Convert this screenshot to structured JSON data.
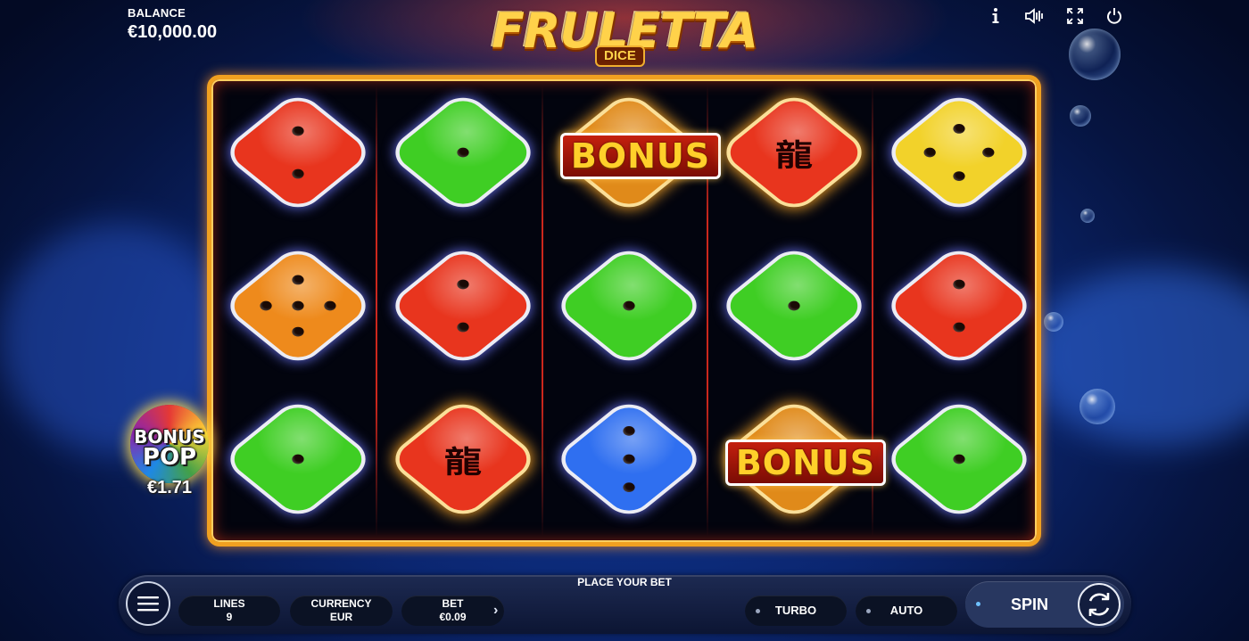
{
  "header": {
    "balance_label": "BALANCE",
    "balance_value": "€10,000.00",
    "logo_main": "FRULETTA",
    "logo_sub": "DICE",
    "icons": [
      "info-icon",
      "sound-icon",
      "fullscreen-icon",
      "power-icon"
    ]
  },
  "reels": {
    "columns": 5,
    "rows": 3,
    "cells": [
      {
        "row": 1,
        "col": 1,
        "symbol": "die",
        "color": "#e8351e",
        "pips": 2
      },
      {
        "row": 1,
        "col": 2,
        "symbol": "die",
        "color": "#3fce24",
        "pips": 1
      },
      {
        "row": 1,
        "col": 3,
        "symbol": "bonus",
        "color": "#e08a1a",
        "label": "BONUS"
      },
      {
        "row": 1,
        "col": 4,
        "symbol": "dragon",
        "color": "#e8351e",
        "glyph": "龍"
      },
      {
        "row": 1,
        "col": 5,
        "symbol": "die",
        "color": "#f2d22a",
        "pips": 4
      },
      {
        "row": 2,
        "col": 1,
        "symbol": "die",
        "color": "#ee8a1c",
        "pips": 5
      },
      {
        "row": 2,
        "col": 2,
        "symbol": "die",
        "color": "#e8351e",
        "pips": 2
      },
      {
        "row": 2,
        "col": 3,
        "symbol": "die",
        "color": "#3fce24",
        "pips": 1
      },
      {
        "row": 2,
        "col": 4,
        "symbol": "die",
        "color": "#3fce24",
        "pips": 1
      },
      {
        "row": 2,
        "col": 5,
        "symbol": "die",
        "color": "#e8351e",
        "pips": 2
      },
      {
        "row": 3,
        "col": 1,
        "symbol": "die",
        "color": "#3fce24",
        "pips": 1
      },
      {
        "row": 3,
        "col": 2,
        "symbol": "dragon",
        "color": "#e8351e",
        "glyph": "龍"
      },
      {
        "row": 3,
        "col": 3,
        "symbol": "die",
        "color": "#2f6ff0",
        "pips": 3
      },
      {
        "row": 3,
        "col": 4,
        "symbol": "bonus",
        "color": "#e08a1a",
        "label": "BONUS"
      },
      {
        "row": 3,
        "col": 5,
        "symbol": "die",
        "color": "#3fce24",
        "pips": 1
      }
    ]
  },
  "bonus_pop": {
    "line1": "BONUS",
    "line2": "POP",
    "amount": "€1.71"
  },
  "controls": {
    "place_bet": "PLACE YOUR BET",
    "lines_label": "LINES",
    "lines_value": "9",
    "currency_label": "CURRENCY",
    "currency_value": "EUR",
    "bet_label": "BET",
    "bet_value": "€0.09",
    "turbo_label": "TURBO",
    "auto_label": "AUTO",
    "spin_label": "SPIN"
  }
}
